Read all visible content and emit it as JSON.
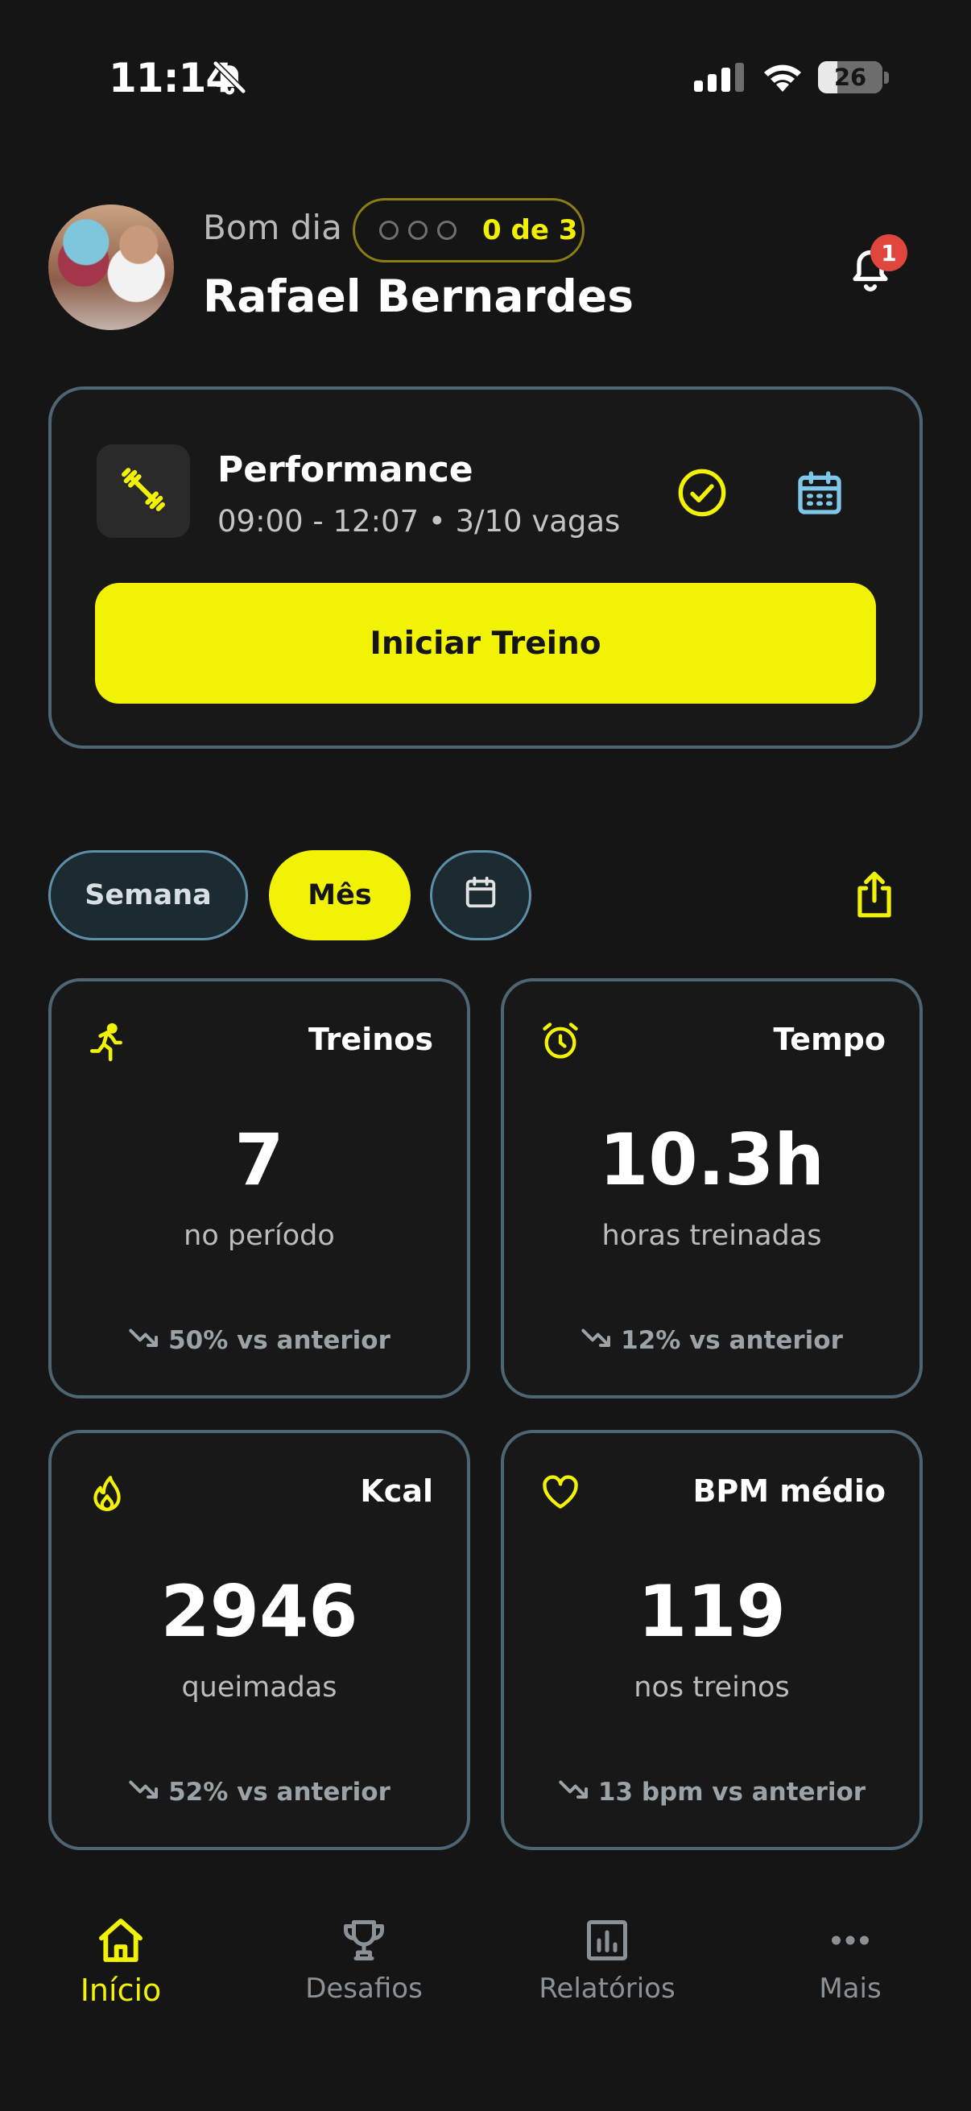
{
  "status_bar": {
    "time": "11:14",
    "battery": "26",
    "battery_level": 0.26
  },
  "header": {
    "greeting": "Bom dia",
    "user_name": "Rafael Bernardes",
    "streak": {
      "text": "0 de 3",
      "completed": 0,
      "total": 3
    },
    "notifications_count": "1"
  },
  "workout": {
    "title": "Performance",
    "subtitle": "09:00 - 12:07 • 3/10 vagas",
    "start_label": "Iniciar Treino"
  },
  "period_filter": {
    "options": [
      "Semana",
      "Mês"
    ],
    "selected": "Mês"
  },
  "stats": [
    {
      "title": "Treinos",
      "value": "7",
      "caption": "no período",
      "trend": "50% vs anterior",
      "icon": "running-icon"
    },
    {
      "title": "Tempo",
      "value": "10.3h",
      "caption": "horas treinadas",
      "trend": "12% vs anterior",
      "icon": "alarm-clock-icon"
    },
    {
      "title": "Kcal",
      "value": "2946",
      "caption": "queimadas",
      "trend": "52% vs anterior",
      "icon": "flame-icon"
    },
    {
      "title": "BPM médio",
      "value": "119",
      "caption": "nos treinos",
      "trend": "13 bpm vs anterior",
      "icon": "heart-icon"
    }
  ],
  "nav": {
    "items": [
      {
        "label": "Início",
        "icon": "home-icon",
        "active": true
      },
      {
        "label": "Desafios",
        "icon": "trophy-icon",
        "active": false
      },
      {
        "label": "Relatórios",
        "icon": "bar-chart-icon",
        "active": false
      },
      {
        "label": "Mais",
        "icon": "more-icon",
        "active": false
      }
    ]
  },
  "colors": {
    "accent": "#f2f205",
    "card_border": "#4e6673",
    "background": "#151515",
    "badge": "#e0463d"
  }
}
